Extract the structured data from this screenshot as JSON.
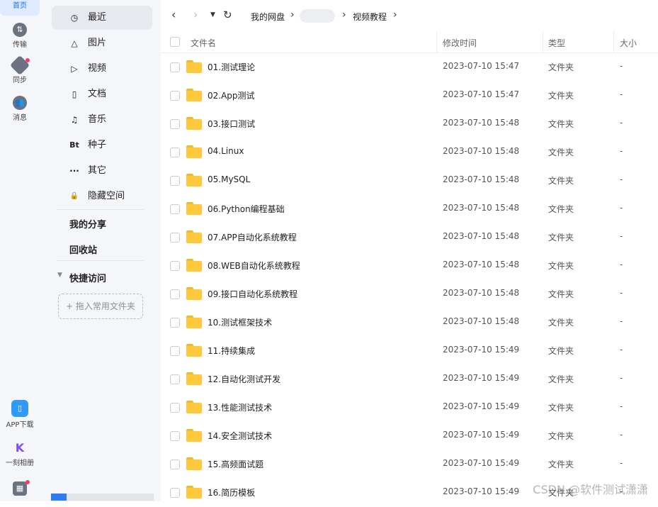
{
  "rail": {
    "home": "首页",
    "transfer": "传输",
    "sync": "同步",
    "messages": "消息",
    "app_download": "APP下载",
    "album": "一刻相册"
  },
  "sidebar": {
    "items": [
      {
        "label": "最近",
        "icon": "clock-icon",
        "glyph": "◷"
      },
      {
        "label": "图片",
        "icon": "image-icon",
        "glyph": "△"
      },
      {
        "label": "视频",
        "icon": "play-icon",
        "glyph": "▷"
      },
      {
        "label": "文档",
        "icon": "document-icon",
        "glyph": "▯"
      },
      {
        "label": "音乐",
        "icon": "headphones-icon",
        "glyph": "♫"
      },
      {
        "label": "种子",
        "icon": "bt-icon",
        "glyph": "Bt"
      },
      {
        "label": "其它",
        "icon": "more-icon",
        "glyph": "···"
      },
      {
        "label": "隐藏空间",
        "icon": "lock-icon",
        "glyph": "🔒"
      }
    ],
    "my_share": "我的分享",
    "recycle_bin": "回收站",
    "quick_access": "快捷访问",
    "drop_hint": "+ 拖入常用文件夹",
    "storage_used_fraction": 0.15
  },
  "breadcrumb": {
    "root": "我的网盘",
    "current": "视频教程"
  },
  "table": {
    "headers": {
      "name": "文件名",
      "modified": "修改时间",
      "type": "类型",
      "size": "大小"
    },
    "rows": [
      {
        "name": "01.测试理论",
        "modified": "2023-07-10 15:47",
        "type": "文件夹",
        "size": "-"
      },
      {
        "name": "02.App测试",
        "modified": "2023-07-10 15:47",
        "type": "文件夹",
        "size": "-"
      },
      {
        "name": "03.接口测试",
        "modified": "2023-07-10 15:48",
        "type": "文件夹",
        "size": "-"
      },
      {
        "name": "04.Linux",
        "modified": "2023-07-10 15:48",
        "type": "文件夹",
        "size": "-"
      },
      {
        "name": "05.MySQL",
        "modified": "2023-07-10 15:48",
        "type": "文件夹",
        "size": "-"
      },
      {
        "name": "06.Python编程基础",
        "modified": "2023-07-10 15:48",
        "type": "文件夹",
        "size": "-"
      },
      {
        "name": "07.APP自动化系统教程",
        "modified": "2023-07-10 15:48",
        "type": "文件夹",
        "size": "-"
      },
      {
        "name": "08.WEB自动化系统教程",
        "modified": "2023-07-10 15:48",
        "type": "文件夹",
        "size": "-"
      },
      {
        "name": "09.接口自动化系统教程",
        "modified": "2023-07-10 15:48",
        "type": "文件夹",
        "size": "-"
      },
      {
        "name": "10.测试框架技术",
        "modified": "2023-07-10 15:48",
        "type": "文件夹",
        "size": "-"
      },
      {
        "name": "11.持续集成",
        "modified": "2023-07-10 15:49",
        "type": "文件夹",
        "size": "-"
      },
      {
        "name": "12.自动化测试开发",
        "modified": "2023-07-10 15:49",
        "type": "文件夹",
        "size": "-"
      },
      {
        "name": "13.性能测试技术",
        "modified": "2023-07-10 15:49",
        "type": "文件夹",
        "size": "-"
      },
      {
        "name": "14.安全测试技术",
        "modified": "2023-07-10 15:49",
        "type": "文件夹",
        "size": "-"
      },
      {
        "name": "15.高频面试题",
        "modified": "2023-07-10 15:49",
        "type": "文件夹",
        "size": "-"
      },
      {
        "name": "16.简历模板",
        "modified": "2023-07-10 15:49",
        "type": "文件夹",
        "size": "-"
      }
    ]
  },
  "watermark": "CSDN @软件测试潇潇",
  "colors": {
    "accent": "#2f7bf6",
    "folder": "#ffc83d",
    "badge": "#f23c6a"
  }
}
